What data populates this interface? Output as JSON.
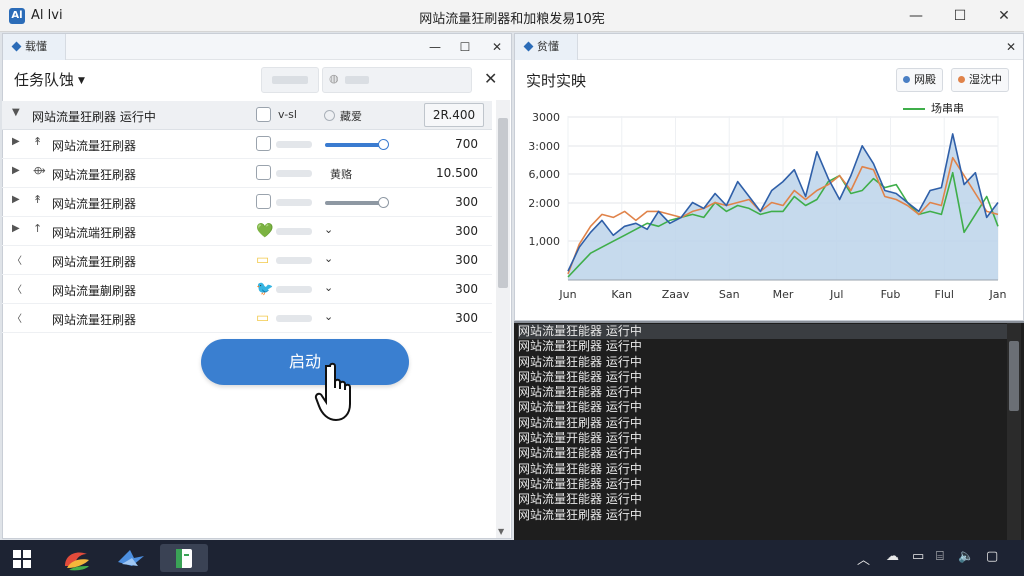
{
  "app": {
    "logo": "Al",
    "name": "Al lvi",
    "window_title": "网站流量狂刷器和加粮发易10宪"
  },
  "window_controls": [
    "—",
    "☐",
    "✕"
  ],
  "left_pane": {
    "tab": "载懂",
    "controls": [
      "—",
      "☐",
      "✕"
    ],
    "queue_title": "任务队蚀",
    "close_label": "✕",
    "rows": [
      {
        "type": "group",
        "arrow": "▼",
        "name": "网站流量狂刷器 运行中",
        "check_label": "v-sl",
        "radio_label": "藏爱",
        "value": "2R.400"
      },
      {
        "type": "slider_blue",
        "arrow": "▶",
        "icon": "↟",
        "name": "网站流量狂刷器",
        "value": "700"
      },
      {
        "type": "text",
        "arrow": "▶",
        "icon": "⟴",
        "name": "网站流量狂刷器",
        "mid": "黄赂",
        "value": "10.500"
      },
      {
        "type": "slider_gray",
        "arrow": "▶",
        "icon": "↟",
        "name": "网站流量狂刷器",
        "value": "300"
      },
      {
        "type": "badge",
        "badge": "💚",
        "badge_color": "#3fae4a",
        "arrow": "▶",
        "icon": "↑",
        "name": "网站流端狂刷器",
        "dd": "⌄",
        "value": "300"
      },
      {
        "type": "badge",
        "badge": "▭",
        "badge_color": "#f2c94c",
        "arrow": "〈",
        "icon": "",
        "name": "网站流量狂刷器",
        "dd": "⌄",
        "value": "300"
      },
      {
        "type": "badge",
        "badge": "🐦",
        "badge_color": "#3a9ad9",
        "arrow": "〈",
        "icon": "",
        "name": "网站流量蒯刷器",
        "dd": "⌄",
        "value": "300"
      },
      {
        "type": "badge",
        "badge": "▭",
        "badge_color": "#f2c94c",
        "arrow": "〈",
        "icon": "",
        "name": "网站流量狂刷器",
        "dd": "⌄",
        "value": "300"
      }
    ],
    "start_button": "启动"
  },
  "right_pane": {
    "tab": "贫懂",
    "close_label": "✕",
    "chart_title": "实时实映",
    "legend_buttons": [
      {
        "label": "网殿",
        "color": "#4a7fc4"
      },
      {
        "label": "湿沈中",
        "color": "#e0834a"
      }
    ],
    "legend_line": {
      "label": "场串串",
      "color": "#3fae4a"
    }
  },
  "chart_data": {
    "type": "area",
    "title": "实时实映",
    "x_ticks": [
      "Jun",
      "Kan",
      "Zaav",
      "San",
      "Mer",
      "Jul",
      "Fub",
      "Flul",
      "Jan"
    ],
    "y_ticks": [
      "3000",
      "3:000",
      "6,000",
      "2:000",
      "1,000"
    ],
    "ylim": [
      0,
      5500
    ],
    "grid": true,
    "series": [
      {
        "name": "网殿",
        "color": "#2f5fa8",
        "values": [
          300,
          1100,
          1600,
          2000,
          1500,
          1800,
          1900,
          1700,
          2300,
          1900,
          2100,
          2600,
          2400,
          2900,
          2500,
          3300,
          2800,
          2300,
          3000,
          3300,
          3700,
          2800,
          4300,
          3400,
          2700,
          3500,
          4500,
          3900,
          3000,
          2900,
          2600,
          2300,
          3000,
          3100,
          4900,
          3200,
          3600,
          2100,
          2600
        ]
      },
      {
        "name": "湿沈中",
        "color": "#e0834a",
        "values": [
          200,
          1200,
          1800,
          2200,
          2100,
          2300,
          2000,
          2300,
          2300,
          2200,
          2100,
          2300,
          2400,
          2600,
          2500,
          2600,
          2700,
          2300,
          2600,
          2500,
          3000,
          2700,
          3000,
          3200,
          3500,
          3000,
          3800,
          3700,
          2800,
          2700,
          2500,
          2200,
          2600,
          2500,
          4100,
          3500,
          2900,
          2300,
          2200
        ]
      },
      {
        "name": "场串串",
        "color": "#3fae4a",
        "values": [
          100,
          500,
          900,
          1100,
          1300,
          1500,
          1700,
          1900,
          1800,
          2000,
          2100,
          2200,
          2100,
          2600,
          2300,
          2500,
          2400,
          2200,
          2300,
          2300,
          2800,
          2500,
          2700,
          3300,
          3500,
          2900,
          3000,
          3400,
          3100,
          3200,
          2600,
          2200,
          2300,
          2200,
          3600,
          1600,
          2200,
          2800,
          1800
        ]
      }
    ]
  },
  "console": {
    "lines": [
      "网站流量狂能器 运行中",
      "网站流量狂刷器 运行中",
      "网站流量狂能器 运行中",
      "网站流量狂能器 运行中",
      "网站流量狂能器 运行中",
      "网站流量狂能器 运行中",
      "网站流量狂刷器 运行中",
      "网站流量开能器 运行中",
      "网站流量狂能器 运行中",
      "网站流量狂能器 运行中",
      "网站流量狂能器 运行中",
      "网站流量狂能器 运行中",
      "网站流量狂刷器 运行中"
    ]
  },
  "taskbar": {
    "tray_icons": [
      "chevron-up-icon",
      "cloud-icon",
      "display-icon",
      "network-icon",
      "speaker-icon",
      "notification-icon"
    ]
  }
}
